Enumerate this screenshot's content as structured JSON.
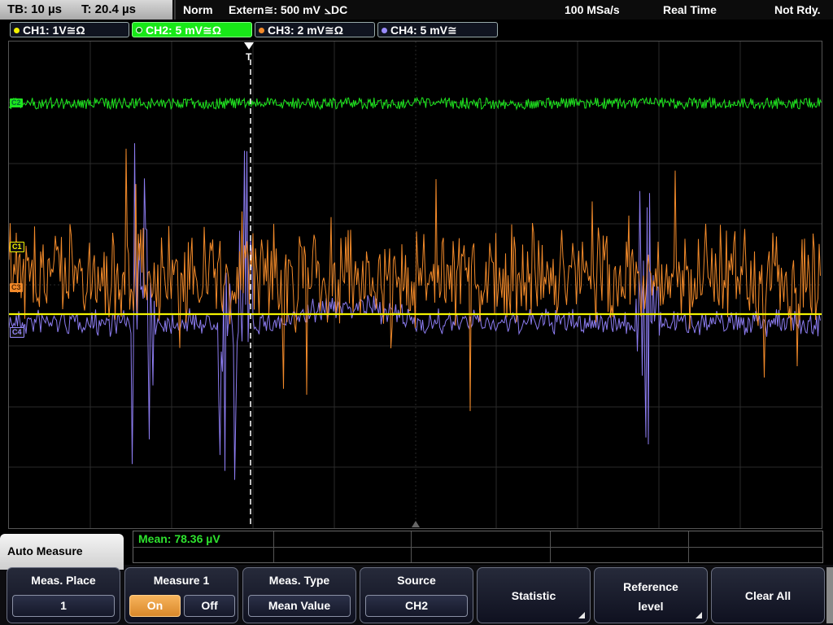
{
  "top": {
    "timebase": "TB: 10 µs",
    "trigger_time": "T: 20.4 µs",
    "mode": "Norm",
    "trigger_source": "Extern≅: 500 mV",
    "trigger_edge": "⦣DC",
    "sample_rate": "100 MSa/s",
    "acq_mode": "Real Time",
    "state": "Not Rdy."
  },
  "channels": [
    {
      "label": "CH1: 1V≅Ω",
      "color": "#f2f200"
    },
    {
      "label": "CH2: 5 mV≅Ω",
      "color": "#1ee61e"
    },
    {
      "label": "CH3: 2 mV≅Ω",
      "color": "#f28a2a"
    },
    {
      "label": "CH4: 5 mV≅",
      "color": "#9a8cff"
    }
  ],
  "markers": {
    "c2": "C2",
    "c1": "C1",
    "c3": "C3",
    "c4": "C4",
    "trigger": "T"
  },
  "measurement": {
    "result": "Mean: 78.36 µV"
  },
  "menu": {
    "title": "Auto Measure",
    "meas_place": {
      "label": "Meas. Place",
      "value": "1"
    },
    "measure1": {
      "label": "Measure 1",
      "on": "On",
      "off": "Off"
    },
    "meas_type": {
      "label": "Meas. Type",
      "value": "Mean Value"
    },
    "source": {
      "label": "Source",
      "value": "CH2"
    },
    "statistic": "Statistic",
    "reference_level": {
      "line1": "Reference",
      "line2": "level"
    },
    "clear_all": "Clear All"
  },
  "colors": {
    "ch1": "#f2f200",
    "ch2": "#1ee61e",
    "ch3": "#f28a2a",
    "ch4": "#8c7cf0",
    "on_button": "#f0a040"
  }
}
